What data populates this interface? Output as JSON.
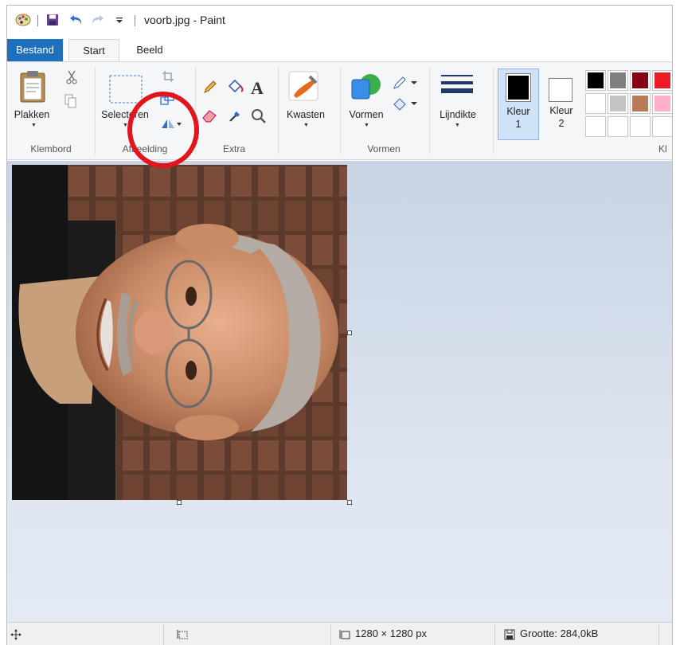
{
  "window": {
    "title": "voorb.jpg - Paint"
  },
  "quick_access": {
    "icons": [
      "paint-app-icon",
      "save-icon",
      "undo-icon",
      "redo-icon",
      "customize-toolbar-icon"
    ]
  },
  "tabs": {
    "file": "Bestand",
    "start": "Start",
    "view": "Beeld"
  },
  "ribbon": {
    "clipboard": {
      "paste_label": "Plakken",
      "group_label": "Klembord"
    },
    "image": {
      "select_label": "Selecteren",
      "group_label": "Afbeelding"
    },
    "tools": {
      "group_label": "Extra"
    },
    "brushes": {
      "label": "Kwasten"
    },
    "shapes": {
      "label": "Vormen",
      "group_label": "Vormen"
    },
    "size": {
      "label": "Lijndikte"
    },
    "colors": {
      "color1_label_line1": "Kleur",
      "color1_label_line2": "1",
      "color2_label_line1": "Kleur",
      "color2_label_line2": "2",
      "color1_value": "#000000",
      "color2_value": "#ffffff",
      "group_label_partial": "Kl",
      "palette_row1": [
        "#000000",
        "#7f7f7f",
        "#880015",
        "#ed1c24"
      ],
      "palette_row2": [
        "#ffffff",
        "#c3c3c3",
        "#b97a57",
        "#ffaec9"
      ],
      "palette_row3": [
        "",
        "",
        "",
        ""
      ]
    }
  },
  "status": {
    "canvas_size": "1280 × 1280 px",
    "file_size": "Grootte: 284,0kB"
  },
  "annotation": {
    "highlight_color": "#e3151c"
  }
}
